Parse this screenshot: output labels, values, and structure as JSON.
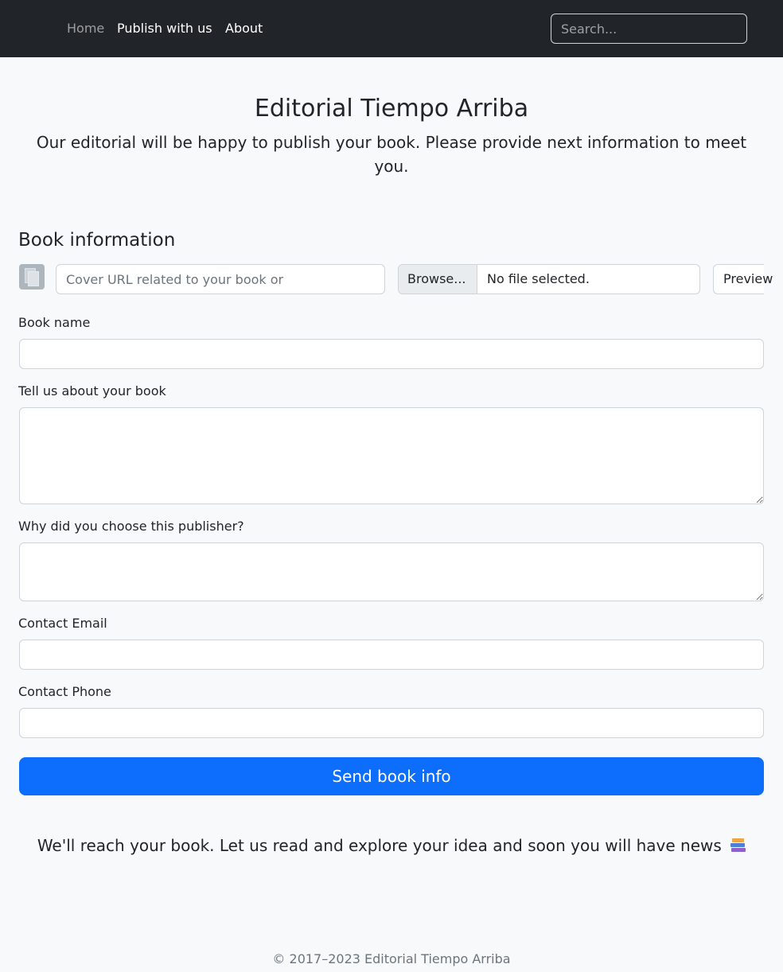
{
  "nav": {
    "links": [
      {
        "label": "Home"
      },
      {
        "label": "Publish with us"
      },
      {
        "label": "About"
      }
    ],
    "search_placeholder": "Search..."
  },
  "header": {
    "title": "Editorial Tiempo Arriba",
    "lead": "Our editorial will be happy to publish your book. Please provide next information to meet you."
  },
  "form": {
    "section_title": "Book information",
    "cover_url_placeholder": "Cover URL related to your book or",
    "file_browse_label": "Browse...",
    "file_status": "No file selected.",
    "preview_label": "Preview",
    "book_name_label": "Book name",
    "about_label": "Tell us about your book",
    "why_label": "Why did you choose this publisher?",
    "email_label": "Contact Email",
    "phone_label": "Contact Phone",
    "submit_label": "Send book info"
  },
  "closing": {
    "text": "We'll reach your book. Let us read and explore your idea and soon you will have news",
    "icon": "books-icon"
  },
  "footer": {
    "text": "© 2017–2023 Editorial Tiempo Arriba"
  },
  "colors": {
    "navbar_bg": "#212529",
    "page_bg": "#f8f9fa",
    "primary": "#0d6efd"
  }
}
